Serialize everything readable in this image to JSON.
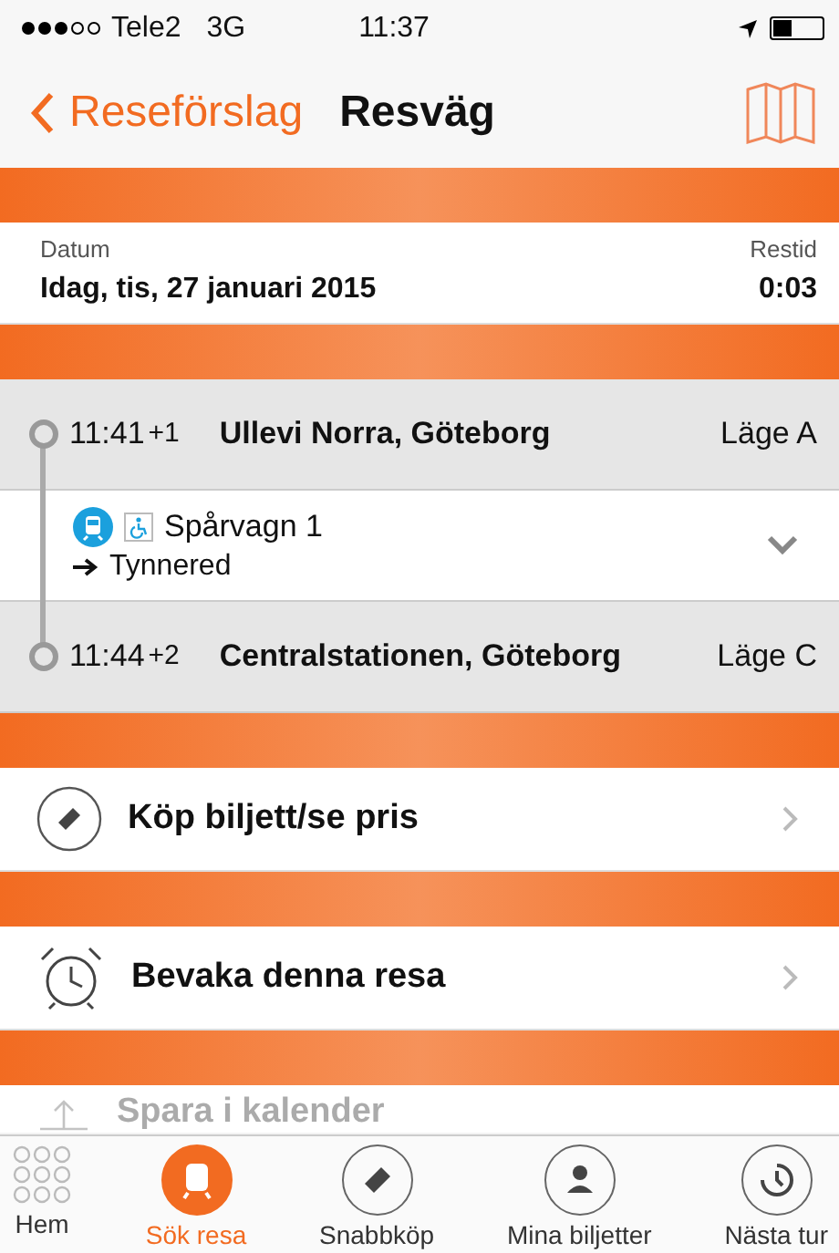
{
  "status_bar": {
    "carrier": "Tele2",
    "network": "3G",
    "time": "11:37"
  },
  "nav": {
    "back": "Reseförslag",
    "title": "Resväg"
  },
  "summary": {
    "date_label": "Datum",
    "date": "Idag, tis, 27 januari 2015",
    "duration_label": "Restid",
    "duration": "0:03"
  },
  "stops": [
    {
      "time": "11:41",
      "delay": "+1",
      "name": "Ullevi Norra, Göteborg",
      "platform": "Läge A"
    },
    {
      "time": "11:44",
      "delay": "+2",
      "name": "Centralstationen, Göteborg",
      "platform": "Läge C"
    }
  ],
  "leg": {
    "line": "Spårvagn 1",
    "direction": "Tynnered",
    "expanded": false
  },
  "actions": [
    {
      "kind": "ticket",
      "label": "Köp biljett/se pris"
    },
    {
      "kind": "alarm",
      "label": "Bevaka denna resa"
    },
    {
      "kind": "share",
      "label": "Spara i kalender"
    }
  ],
  "tab_bar": [
    {
      "kind": "home",
      "label": "Hem",
      "selected": false
    },
    {
      "kind": "tram",
      "label": "Sök resa",
      "selected": true
    },
    {
      "kind": "ticket",
      "label": "Snabbköp",
      "selected": false
    },
    {
      "kind": "person",
      "label": "Mina biljetter",
      "selected": false
    },
    {
      "kind": "clock",
      "label": "Nästa tur",
      "selected": false
    }
  ]
}
